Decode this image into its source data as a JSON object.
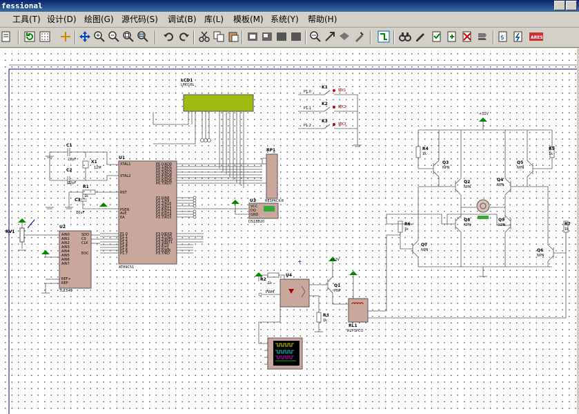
{
  "window": {
    "title": "fessional"
  },
  "menu": [
    "工具(T)",
    "设计(D)",
    "绘图(G)",
    "源代码(S)",
    "调试(B)",
    "库(L)",
    "模板(M)",
    "系统(Y)",
    "帮助(H)"
  ],
  "toolbar_icons": [
    "new-icon",
    "refresh-icon",
    "grid-icon",
    "origin-icon",
    "pan-icon",
    "zoom-in-icon",
    "zoom-out-icon",
    "zoom-all-icon",
    "zoom-area-icon",
    "undo-icon",
    "redo-icon",
    "cut-icon",
    "copy-icon",
    "paste-icon",
    "block-copy-icon",
    "block-move-icon",
    "block-rotate-icon",
    "block-delete-icon",
    "pick-device-icon",
    "make-device-icon",
    "packaging-icon",
    "decompose-icon",
    "wire-autoroute-icon",
    "search-icon",
    "property-assign-icon",
    "new-sheet-icon",
    "remove-sheet-icon",
    "goto-sheet-icon",
    "bill-of-materials-icon",
    "electrical-check-icon",
    "ares-icon"
  ],
  "schematic": {
    "lcd": {
      "ref": "LCD1",
      "part": "LM016L"
    },
    "u1": {
      "ref": "U1",
      "part": "AT89C51",
      "left_pins": [
        "XTAL1",
        "XTAL2",
        "RST",
        "PSEN",
        "ALE",
        "EA"
      ],
      "left_pin_nums": [
        "19",
        "18",
        "9",
        "29",
        "30",
        "31"
      ],
      "left_port": [
        "P1.0",
        "P1.1",
        "P1.2",
        "P1.3",
        "P1.4",
        "P1.5",
        "P1.6",
        "P1.7"
      ],
      "right_p0": [
        "P0.0/AD0",
        "P0.1/AD1",
        "P0.2/AD2",
        "P0.3/AD3",
        "P0.4/AD4",
        "P0.5/AD5",
        "P0.6/AD6",
        "P0.7/AD7"
      ],
      "right_p2": [
        "P2.0/A8",
        "P2.1/A9",
        "P2.2/A10",
        "P2.3/A11",
        "P2.4/A12",
        "P2.5/A13",
        "P2.6/A14",
        "P2.7/A15"
      ],
      "right_p3": [
        "P3.0/RXD",
        "P3.1/TXD",
        "P3.2/INT0",
        "P3.3/INT1",
        "P3.4/T0",
        "P3.5/T1",
        "P3.6/WR",
        "P3.7/RD"
      ]
    },
    "u2": {
      "ref": "U2",
      "part": "TLC549",
      "pins_left": [
        "AIN0",
        "AIN1",
        "AIN2",
        "AIN3",
        "AIN4",
        "AIN5",
        "AIN6",
        "AIN7",
        "REF+",
        "REF-"
      ],
      "pins_right": [
        "SDO",
        "CS",
        "CLK",
        "EOC"
      ]
    },
    "u3": {
      "ref": "U3",
      "part": "DS18B20",
      "pins": [
        "VCC",
        "DQ",
        "GND"
      ]
    },
    "u4": {
      "ref": "U4"
    },
    "rp1": {
      "ref": "RP1",
      "part": "RESPACK-8"
    },
    "rv1": {
      "ref": "RV1"
    },
    "x1": {
      "ref": "X1",
      "value": "12M"
    },
    "c1": {
      "ref": "C1",
      "value": "22pF"
    },
    "c2": {
      "ref": "C2",
      "value": "22pF"
    },
    "c3": {
      "ref": "C3",
      "value": "10uF"
    },
    "r1": {
      "ref": "R1",
      "value": "1k"
    },
    "r2": {
      "ref": "R2",
      "value": "1k"
    },
    "r3": {
      "ref": "R3",
      "value": "1k"
    },
    "r4": {
      "ref": "R4",
      "value": "1k"
    },
    "r5": {
      "ref": "R5",
      "value": "1k"
    },
    "r6": {
      "ref": "R6",
      "value": "1k"
    },
    "r7": {
      "ref": "R7",
      "value": "1k"
    },
    "keys": [
      {
        "ref": "K1",
        "label": "键K1"
      },
      {
        "ref": "K2",
        "label": "键K2"
      },
      {
        "ref": "K3",
        "label": "键K3"
      }
    ],
    "key_nets": [
      "P1.0",
      "P1.1",
      "P1.2"
    ],
    "transistors": [
      "Q1",
      "Q2",
      "Q3",
      "Q4",
      "Q5",
      "Q6",
      "Q7",
      "Q8",
      "Q9"
    ],
    "transistor_type": "NPN",
    "q1_type": "PNP",
    "relay": {
      "ref": "RL1",
      "part": "RLY-SPCO"
    },
    "supply": "+12V",
    "pwm_net": "PWM",
    "motor": {
      "ref": "M"
    }
  }
}
